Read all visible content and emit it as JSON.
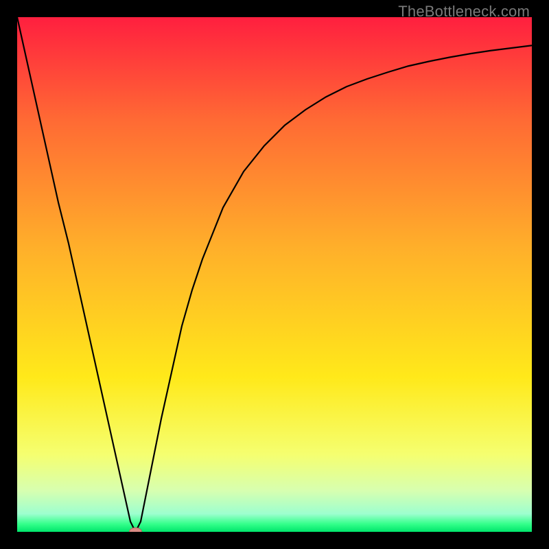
{
  "attribution": "TheBottleneck.com",
  "chart_data": {
    "type": "line",
    "title": "",
    "xlabel": "",
    "ylabel": "",
    "xlim": [
      0,
      100
    ],
    "ylim": [
      0,
      100
    ],
    "grid": false,
    "legend": false,
    "series": [
      {
        "name": "bottleneck-curve",
        "x": [
          0,
          2,
          4,
          6,
          8,
          10,
          12,
          14,
          16,
          18,
          20,
          22,
          23,
          24,
          26,
          28,
          30,
          32,
          34,
          36,
          38,
          40,
          44,
          48,
          52,
          56,
          60,
          64,
          68,
          72,
          76,
          80,
          84,
          88,
          92,
          96,
          100
        ],
        "y": [
          100,
          91,
          82,
          73,
          64,
          56,
          47,
          38,
          29,
          20,
          11,
          2,
          0,
          2,
          12,
          22,
          31,
          40,
          47,
          53,
          58,
          63,
          70,
          75,
          79,
          82,
          84.5,
          86.5,
          88,
          89.3,
          90.5,
          91.4,
          92.2,
          92.9,
          93.5,
          94,
          94.5
        ]
      }
    ],
    "markers": [
      {
        "name": "current-point",
        "x": 23,
        "y": 0,
        "color": "#d98b84",
        "shape": "ellipse"
      }
    ],
    "background_gradient": {
      "stops": [
        {
          "pos": 0.0,
          "color": "#ff1f3f"
        },
        {
          "pos": 0.2,
          "color": "#ff6a34"
        },
        {
          "pos": 0.45,
          "color": "#ffb02a"
        },
        {
          "pos": 0.7,
          "color": "#ffe91a"
        },
        {
          "pos": 0.85,
          "color": "#f5ff70"
        },
        {
          "pos": 0.92,
          "color": "#d7ffb0"
        },
        {
          "pos": 0.965,
          "color": "#9dffcf"
        },
        {
          "pos": 0.985,
          "color": "#33ff8a"
        },
        {
          "pos": 1.0,
          "color": "#00e56b"
        }
      ]
    }
  }
}
